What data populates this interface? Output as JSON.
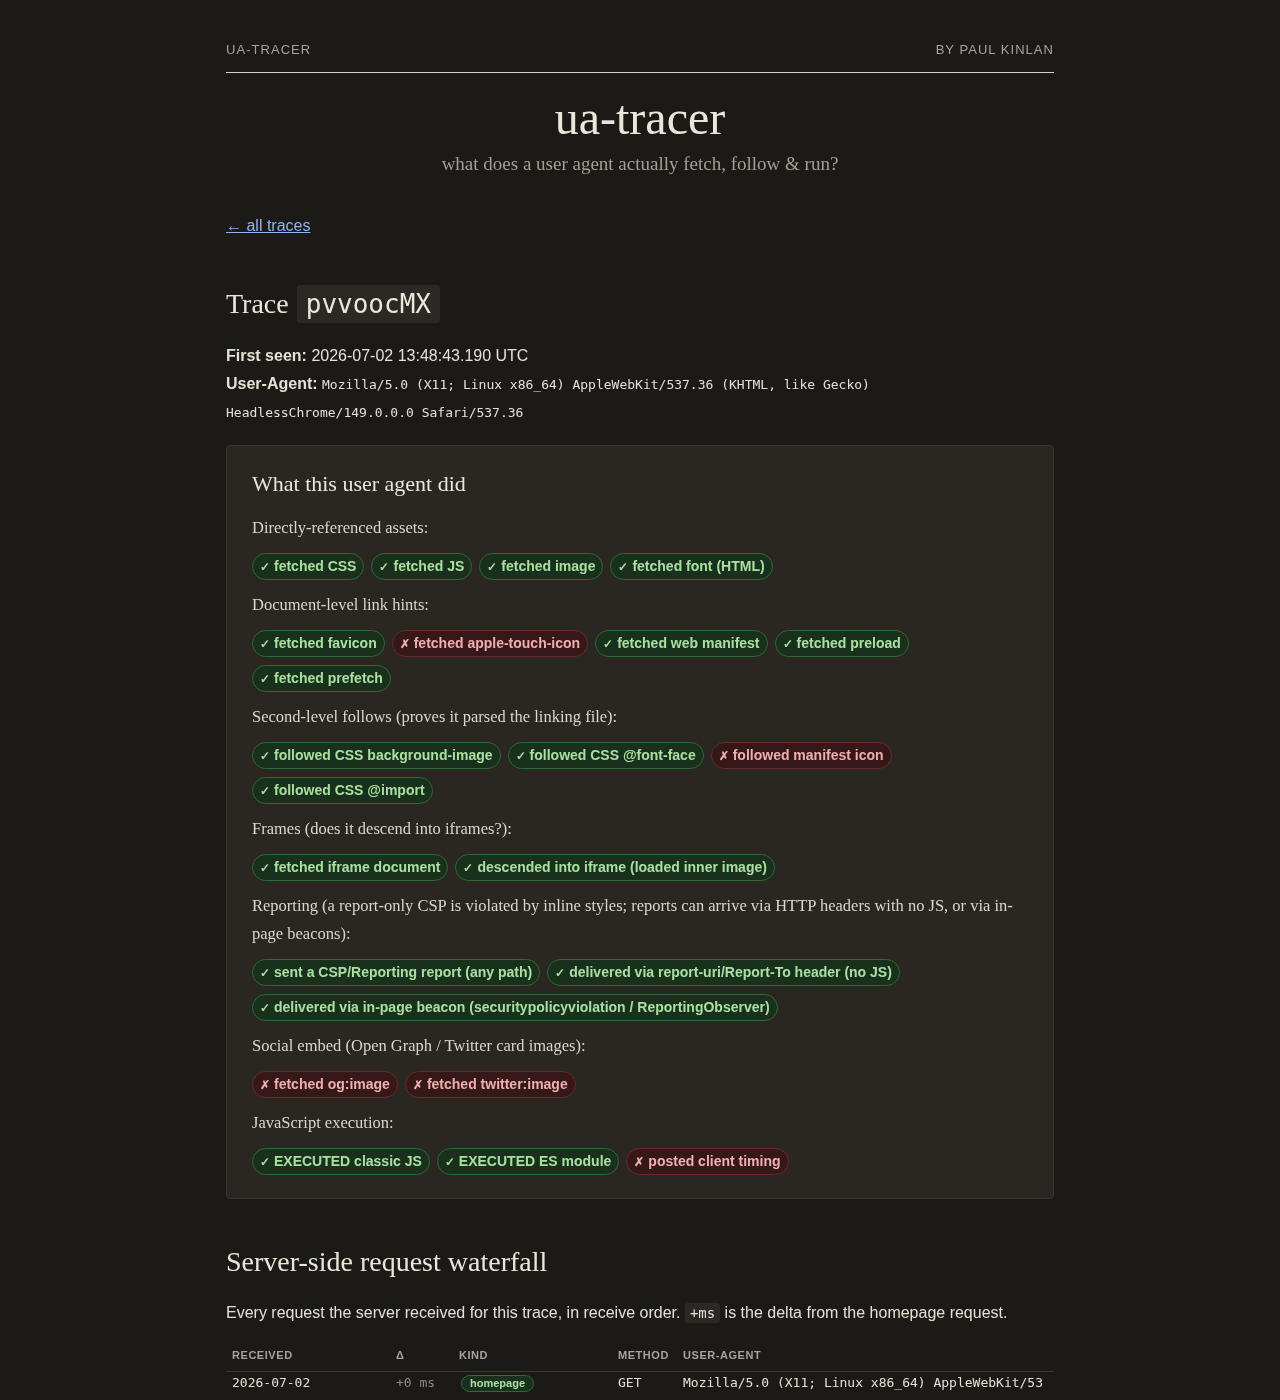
{
  "header": {
    "brand": "UA-TRACER",
    "byline": "BY PAUL KINLAN"
  },
  "hero": {
    "title": "ua-tracer",
    "subtitle": "what does a user agent actually fetch, follow & run?"
  },
  "back_link": "← all traces",
  "trace": {
    "heading": "Trace",
    "id": "pvvoocMX",
    "first_seen_label": "First seen:",
    "first_seen": "2026-07-02 13:48:43.190 UTC",
    "user_agent_label": "User-Agent:",
    "user_agent": "Mozilla/5.0 (X11; Linux x86_64) AppleWebKit/537.36 (KHTML, like Gecko) HeadlessChrome/149.0.0.0 Safari/537.36"
  },
  "summary": {
    "title": "What this user agent did",
    "sections": [
      {
        "label": "Directly-referenced assets:",
        "badges": [
          {
            "mark": "✓",
            "label": "fetched CSS",
            "passed": true
          },
          {
            "mark": "✓",
            "label": "fetched JS",
            "passed": true
          },
          {
            "mark": "✓",
            "label": "fetched image",
            "passed": true
          },
          {
            "mark": "✓",
            "label": "fetched font (HTML)",
            "passed": true
          }
        ]
      },
      {
        "label": "Document-level link hints:",
        "badges": [
          {
            "mark": "✓",
            "label": "fetched favicon",
            "passed": true
          },
          {
            "mark": "✗",
            "label": "fetched apple-touch-icon",
            "passed": false
          },
          {
            "mark": "✓",
            "label": "fetched web manifest",
            "passed": true
          },
          {
            "mark": "✓",
            "label": "fetched preload",
            "passed": true
          },
          {
            "mark": "✓",
            "label": "fetched prefetch",
            "passed": true
          }
        ]
      },
      {
        "label": "Second-level follows (proves it parsed the linking file):",
        "badges": [
          {
            "mark": "✓",
            "label": "followed CSS background-image",
            "passed": true
          },
          {
            "mark": "✓",
            "label": "followed CSS @font-face",
            "passed": true
          },
          {
            "mark": "✗",
            "label": "followed manifest icon",
            "passed": false
          },
          {
            "mark": "✓",
            "label": "followed CSS @import",
            "passed": true
          }
        ]
      },
      {
        "label": "Frames (does it descend into iframes?):",
        "badges": [
          {
            "mark": "✓",
            "label": "fetched iframe document",
            "passed": true
          },
          {
            "mark": "✓",
            "label": "descended into iframe (loaded inner image)",
            "passed": true
          }
        ]
      },
      {
        "label": "Reporting (a report-only CSP is violated by inline styles; reports can arrive via HTTP headers with no JS, or via in-page beacons):",
        "badges": [
          {
            "mark": "✓",
            "label": "sent a CSP/Reporting report (any path)",
            "passed": true
          },
          {
            "mark": "✓",
            "label": "delivered via report-uri/Report-To header (no JS)",
            "passed": true
          },
          {
            "mark": "✓",
            "label": "delivered via in-page beacon (securitypolicyviolation / ReportingObserver)",
            "passed": true
          }
        ]
      },
      {
        "label": "Social embed (Open Graph / Twitter card images):",
        "badges": [
          {
            "mark": "✗",
            "label": "fetched og:image",
            "passed": false
          },
          {
            "mark": "✗",
            "label": "fetched twitter:image",
            "passed": false
          }
        ]
      },
      {
        "label": "JavaScript execution:",
        "badges": [
          {
            "mark": "✓",
            "label": "EXECUTED classic JS",
            "passed": true
          },
          {
            "mark": "✓",
            "label": "EXECUTED ES module",
            "passed": true
          },
          {
            "mark": "✗",
            "label": "posted client timing",
            "passed": false
          }
        ]
      }
    ]
  },
  "waterfall": {
    "title": "Server-side request waterfall",
    "description": {
      "before": "Every request the server received for this trace, in receive order.",
      "code": "+ms",
      "after": "is the delta from the homepage request."
    },
    "table": {
      "columns": [
        "RECEIVED",
        "Δ",
        "KIND",
        "METHOD",
        "USER-AGENT"
      ],
      "rows": [
        {
          "received": "2026-07-02",
          "delta": "+0 ms",
          "kind": "homepage",
          "method": "GET",
          "user_agent": "Mozilla/5.0 (X11; Linux x86_64) AppleWebKit/53"
        }
      ]
    }
  }
}
